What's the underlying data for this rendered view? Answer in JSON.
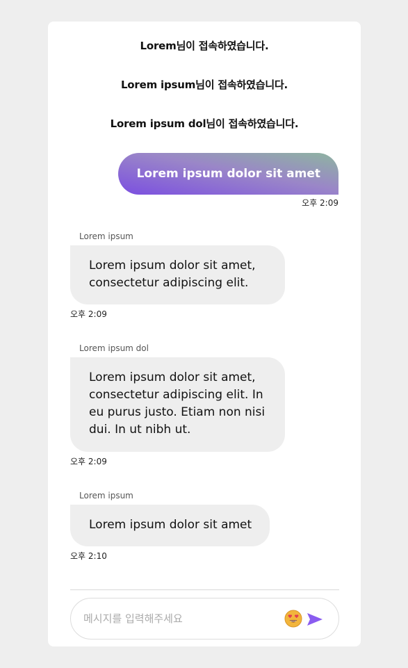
{
  "system_messages": [
    "Lorem님이 접속하였습니다.",
    "Lorem ipsum님이 접속하였습니다.",
    "Lorem ipsum dol님이 접속하였습니다."
  ],
  "outgoing": {
    "text": "Lorem ipsum dolor sit amet",
    "time": "오후 2:09"
  },
  "incoming": [
    {
      "sender": "Lorem ipsum",
      "text": "Lorem ipsum dolor sit amet, consectetur adipiscing elit.",
      "time": "오후 2:09"
    },
    {
      "sender": "Lorem ipsum dol",
      "text": "Lorem ipsum dolor sit amet, consectetur adipiscing elit. In eu purus justo. Etiam non nisi dui. In ut nibh ut.",
      "time": "오후 2:09"
    },
    {
      "sender": "Lorem ipsum",
      "text": "Lorem ipsum dolor sit amet",
      "time": "오후 2:10"
    }
  ],
  "composer": {
    "placeholder": "메시지를 입력해주세요",
    "emoji_icon": "heart-eyes-emoji-icon",
    "send_icon": "send-icon"
  },
  "colors": {
    "page_background": "#eeeeee",
    "card_background": "#ffffff",
    "incoming_bubble": "#eeeeee",
    "outgoing_gradient_start": "#7b4fe0",
    "outgoing_gradient_end": "#8eb5a0",
    "send_icon": "#8a5cf0"
  }
}
